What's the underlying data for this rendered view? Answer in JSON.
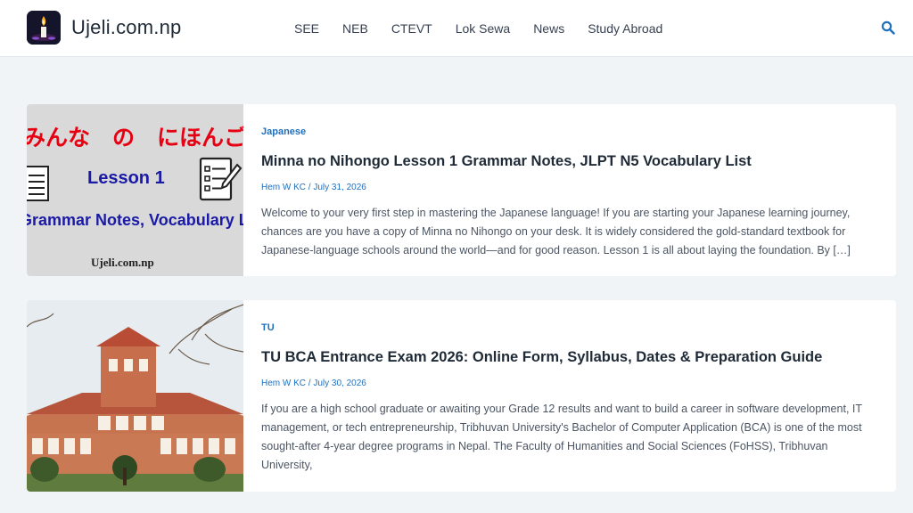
{
  "header": {
    "site_name": "Ujeli.com.np",
    "nav": [
      "SEE",
      "NEB",
      "CTEVT",
      "Lok Sewa",
      "News",
      "Study Abroad"
    ]
  },
  "posts": [
    {
      "category": "Japanese",
      "title": "Minna no Nihongo Lesson 1 Grammar Notes, JLPT N5 Vocabulary List",
      "meta": "Hem W KC / July 31, 2026",
      "excerpt": "Welcome to your very first step in mastering the Japanese language! If you are starting your Japanese learning journey, chances are you have a copy of Minna no Nihongo on your desk. It is widely considered the gold-standard textbook for Japanese-language schools around the world—and for good reason. Lesson 1 is all about laying the foundation. By […]",
      "thumb": {
        "jp_text": "みんな　の　にほんご",
        "lesson": "Lesson 1",
        "subtitle": "Grammar Notes, Vocabulary List",
        "watermark": "Ujeli.com.np"
      }
    },
    {
      "category": "TU",
      "title": "TU BCA Entrance Exam 2026: Online Form, Syllabus, Dates & Preparation Guide",
      "meta": "Hem W KC / July 30, 2026",
      "excerpt": "If you are a high school graduate or awaiting your Grade 12 results and want to build a career in software development, IT management, or tech entrepreneurship, Tribhuvan University's Bachelor of Computer Application (BCA) is one of the most sought-after 4-year degree programs in Nepal. The Faculty of Humanities and Social Sciences (FoHSS), Tribhuvan University,"
    }
  ],
  "colors": {
    "accent": "#1e6fbd",
    "background": "#f1f4f7",
    "card": "#ffffff"
  },
  "icons": {
    "search": "search-icon",
    "logo": "candle-logo-icon"
  }
}
